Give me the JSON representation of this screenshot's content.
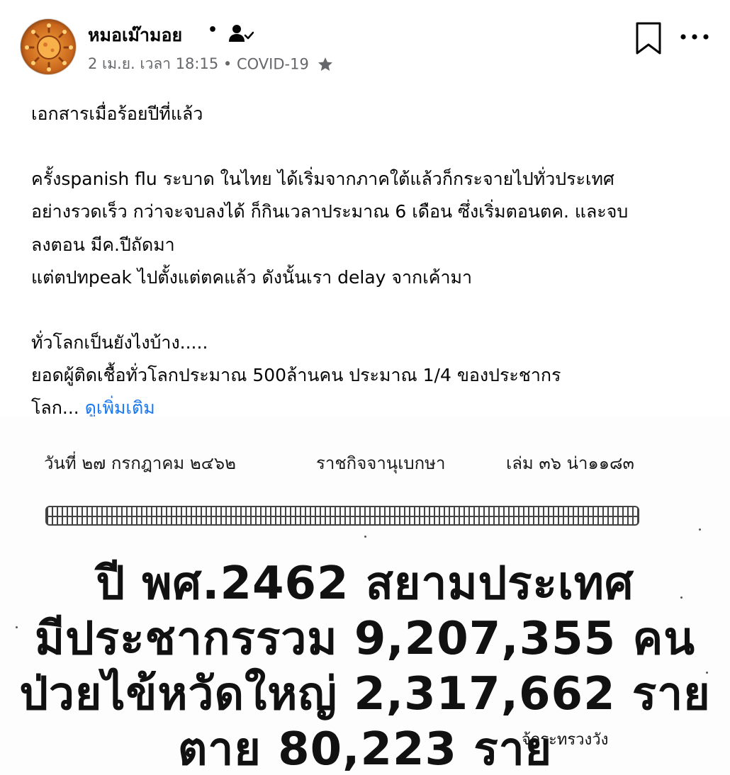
{
  "post": {
    "author": "หมอเม๊ามอย",
    "dot": "•",
    "date": "2 เม.ย. เวลา 18:15",
    "meta_dot": "•",
    "group": "COVID-19",
    "icons": {
      "follow": "person-check-icon",
      "star": "star-icon",
      "bookmark": "bookmark-icon",
      "more": "more-icon"
    }
  },
  "content": {
    "line1": "เอกสารเมื่อร้อยปีที่แล้ว",
    "line2": "ครั้งspanish flu ระบาด ในไทย ได้เริ่มจากภาคใต้แล้วก็กระจายไปทั่วประเทศ",
    "line3": "อย่างรวดเร็ว กว่าจะจบลงได้ ก็กินเวลาประมาณ 6 เดือน ซึ่งเริ่มตอนตค. และจบ",
    "line4": "ลงตอน มีค.ปีถัดมา",
    "line5": "แต่ตปทpeak ไปตั้งแต่ตคแล้ว ดังนั้นเรา delay จากเค้ามา",
    "line6": "ทั่วโลกเป็นยังไงบ้าง.....",
    "line7": "ยอดผู้ติดเชื้อทั่วโลกประมาณ 500ล้านคน ประมาณ 1/4 ของประชากร",
    "line8": "โลก...",
    "see_more": "ดูเพิ่มเติม"
  },
  "image": {
    "doc_date": "วันที่ ๒๗ กรกฎาคม ๒๔๖๒",
    "doc_title": "ราชกิจจานุเบกษา",
    "doc_volume": "เล่ม ๓๖ น่า๑๑๘๓",
    "line1": "ปี พศ.2462 สยามประเทศ",
    "line2": "มีประชากรรวม 9,207,355 คน",
    "line3": "ป่วยไข้หวัดใหญ่ 2,317,662 ราย",
    "line4": "ตาย 80,223 ราย",
    "source": "จ้กระทรวงวัง"
  },
  "colors": {
    "link": "#1877f2",
    "meta": "#65676b",
    "text": "#050505",
    "avatar": "#e0892a"
  }
}
